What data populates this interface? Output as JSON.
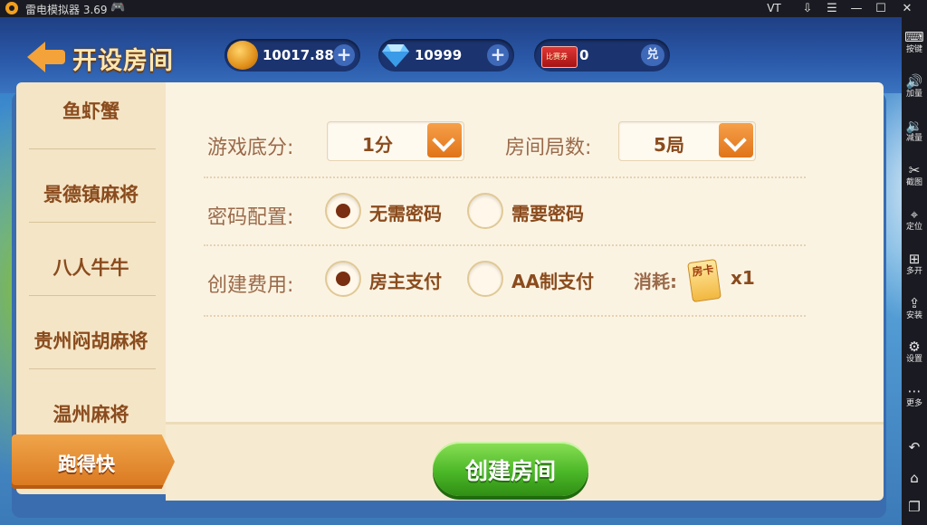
{
  "window": {
    "app_title": "雷电模拟器 3.69",
    "vt_label": "VT",
    "controls": [
      "⇩",
      "☰",
      "—",
      "☐",
      "✕"
    ]
  },
  "sidebar": {
    "items": [
      {
        "icon": "keyboard-icon",
        "glyph": "⌨",
        "label": "按键"
      },
      {
        "icon": "volume-up-icon",
        "glyph": "🔊",
        "label": "加量"
      },
      {
        "icon": "volume-down-icon",
        "glyph": "🔉",
        "label": "减量"
      },
      {
        "icon": "scissors-icon",
        "glyph": "✂",
        "label": "截图"
      },
      {
        "icon": "location-icon",
        "glyph": "⌖",
        "label": "定位"
      },
      {
        "icon": "multi-open-icon",
        "glyph": "⊞",
        "label": "多开"
      },
      {
        "icon": "apk-install-icon",
        "glyph": "⇪",
        "label": "安装"
      },
      {
        "icon": "gear-icon",
        "glyph": "⚙",
        "label": "设置"
      },
      {
        "icon": "more-icon",
        "glyph": "⋯",
        "label": "更多"
      }
    ],
    "nav": [
      {
        "icon": "back-nav-icon",
        "glyph": "↶"
      },
      {
        "icon": "home-nav-icon",
        "glyph": "⌂"
      },
      {
        "icon": "recents-nav-icon",
        "glyph": "❐"
      }
    ]
  },
  "header": {
    "title": "开设房间",
    "gold": "10017.88",
    "diamonds": "10999",
    "ticket_label": "比赛券",
    "tickets": "0",
    "exchange": "兑",
    "plus": "+"
  },
  "games": [
    "鱼虾蟹",
    "景德镇麻将",
    "八人牛牛",
    "贵州闷胡麻将",
    "温州麻将"
  ],
  "selected_game": "跑得快",
  "settings": {
    "base_score_label": "游戏底分:",
    "base_score_value": "1分",
    "rounds_label": "房间局数:",
    "rounds_value": "5局",
    "password_label": "密码配置:",
    "password_options": [
      "无需密码",
      "需要密码"
    ],
    "password_selected": 0,
    "fee_label": "创建费用:",
    "fee_options": [
      "房主支付",
      "AA制支付"
    ],
    "fee_selected": 0,
    "cost_label": "消耗:",
    "card_text": "房卡",
    "cost_value": "x1"
  },
  "create_button": "创建房间",
  "colors": {
    "accent_orange": "#e07419",
    "button_green": "#4cb828",
    "panel_cream": "#fbf3e2",
    "text_brown": "#8a4b1d"
  }
}
